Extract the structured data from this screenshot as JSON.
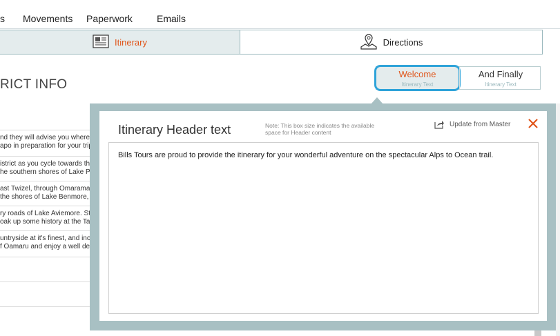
{
  "nav": {
    "items": [
      "s",
      "Movements",
      "Paperwork",
      "Emails"
    ]
  },
  "tabs": {
    "itinerary_label": "Itinerary",
    "directions_label": "Directions"
  },
  "page": {
    "district_title": "RICT INFO",
    "rows": [
      [
        "nd they will advise you where t",
        "apo in preparation for your trip"
      ],
      [
        "istrict as you cycle towards the",
        "he southern shores of Lake Pu"
      ],
      [
        "ast Twizel, through Omarama",
        "the shores of Lake Benmore, v"
      ],
      [
        "ry roads of Lake Aviemore.  St",
        "oak up some history at the Tak"
      ],
      [
        "untryside at it's finest, and incre",
        "f Oamaru and enjoy a well des"
      ]
    ]
  },
  "toggles": {
    "welcome": {
      "label": "Welcome",
      "sub": "Itinerary Text"
    },
    "finally": {
      "label": "And Finally",
      "sub": "Itinerary Text"
    }
  },
  "popover": {
    "title": "Itinerary Header text",
    "note": "Note: This box size indicates the available space for Header content",
    "update_label": "Update from Master",
    "body_text": "Bills Tours are proud to provide the itinerary for your wonderful adventure on the spectacular Alps to Ocean trail."
  },
  "colors": {
    "accent_orange": "#e0561b",
    "focus_blue": "#2ea3d9",
    "panel_teal": "#a8c0c3"
  }
}
